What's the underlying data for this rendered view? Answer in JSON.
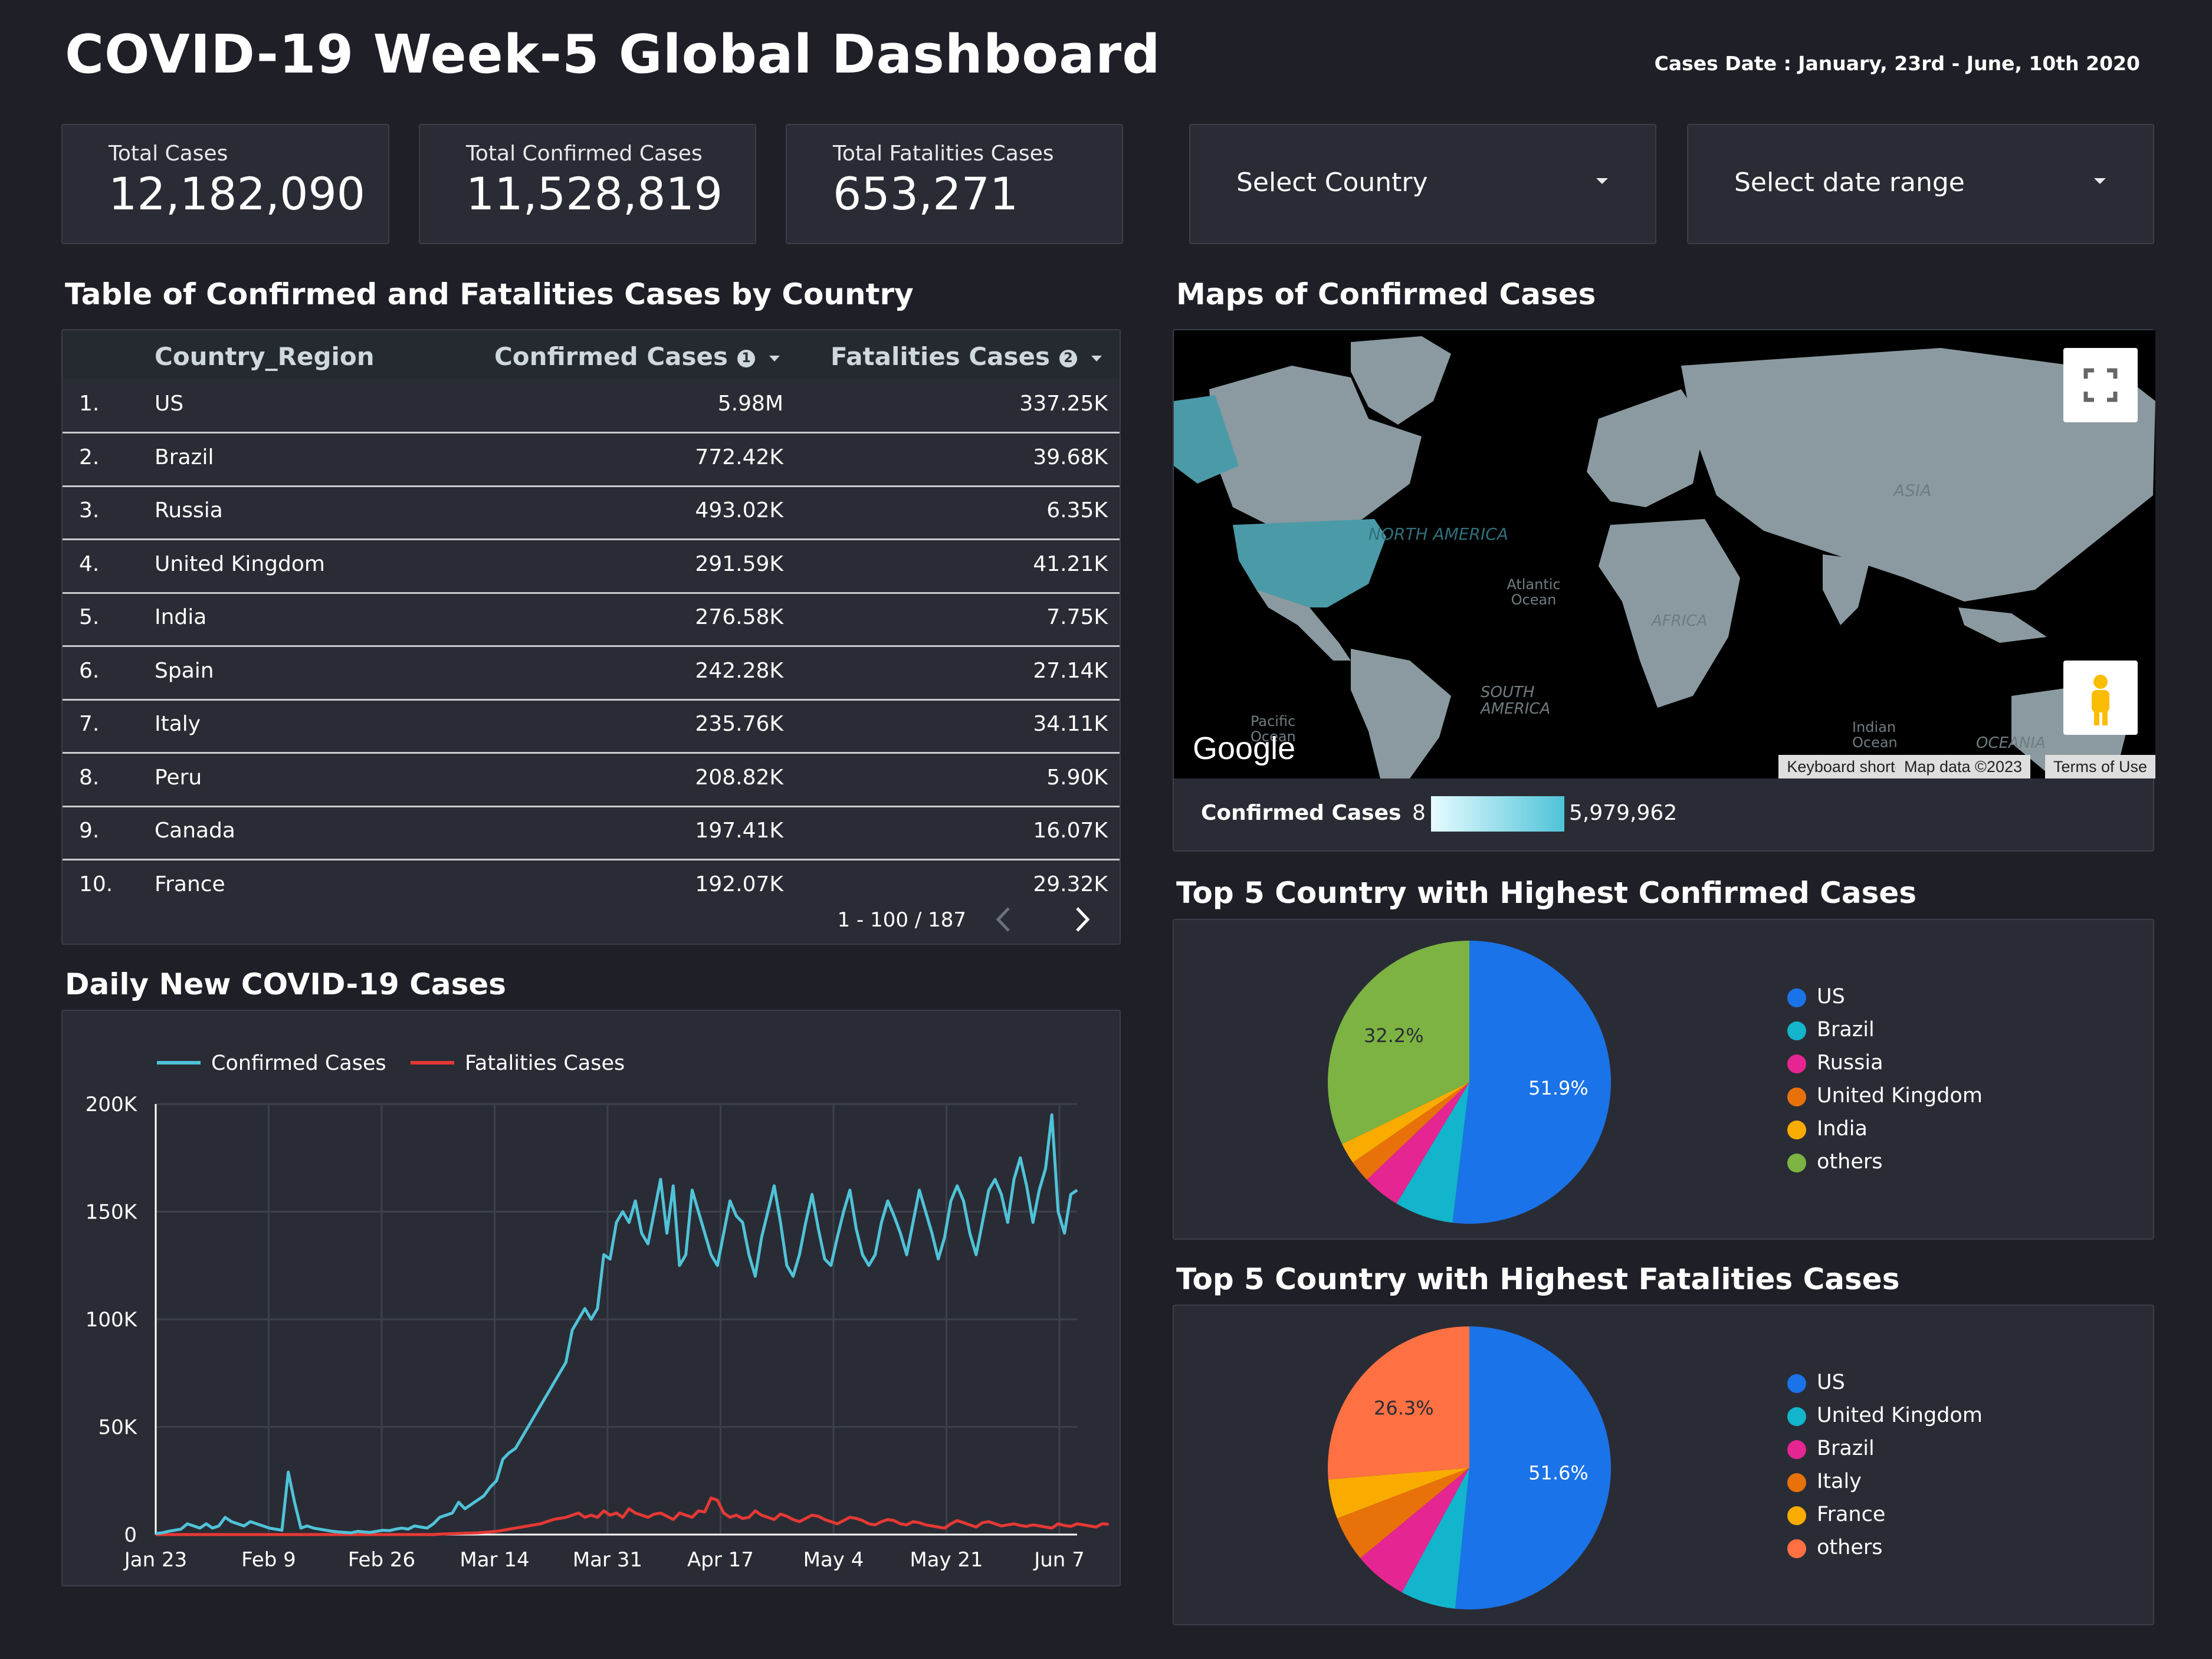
{
  "header": {
    "title": "COVID-19 Week-5 Global Dashboard",
    "date_range": "Cases Date : January, 23rd - June, 10th 2020"
  },
  "kpis": [
    {
      "label": "Total Cases",
      "value": "12,182,090"
    },
    {
      "label": "Total Confirmed Cases",
      "value": "11,528,819"
    },
    {
      "label": "Total Fatalities Cases",
      "value": "653,271"
    }
  ],
  "filters": {
    "country": "Select Country",
    "date": "Select date range"
  },
  "table": {
    "title": "Table of Confirmed and Fatalities Cases by Country",
    "headers": {
      "country": "Country_Region",
      "confirmed": "Confirmed Cases",
      "fatalities": "Fatalities Cases",
      "confirmed_info": "1",
      "fatalities_info": "2"
    },
    "rows": [
      {
        "n": "1.",
        "country": "US",
        "confirmed": "5.98M",
        "fatalities": "337.25K"
      },
      {
        "n": "2.",
        "country": "Brazil",
        "confirmed": "772.42K",
        "fatalities": "39.68K"
      },
      {
        "n": "3.",
        "country": "Russia",
        "confirmed": "493.02K",
        "fatalities": "6.35K"
      },
      {
        "n": "4.",
        "country": "United Kingdom",
        "confirmed": "291.59K",
        "fatalities": "41.21K"
      },
      {
        "n": "5.",
        "country": "India",
        "confirmed": "276.58K",
        "fatalities": "7.75K"
      },
      {
        "n": "6.",
        "country": "Spain",
        "confirmed": "242.28K",
        "fatalities": "27.14K"
      },
      {
        "n": "7.",
        "country": "Italy",
        "confirmed": "235.76K",
        "fatalities": "34.11K"
      },
      {
        "n": "8.",
        "country": "Peru",
        "confirmed": "208.82K",
        "fatalities": "5.90K"
      },
      {
        "n": "9.",
        "country": "Canada",
        "confirmed": "197.41K",
        "fatalities": "16.07K"
      },
      {
        "n": "10.",
        "country": "France",
        "confirmed": "192.07K",
        "fatalities": "29.32K"
      }
    ],
    "pagination": "1 - 100 / 187"
  },
  "map": {
    "title": "Maps of Confirmed Cases",
    "labels": {
      "north_america": "NORTH AMERICA",
      "south_america": "SOUTH AMERICA",
      "asia": "ASIA",
      "africa": "AFRICA",
      "oceania": "OCEANIA",
      "atlantic": "Atlantic Ocean",
      "pacific": "Pacific Ocean",
      "indian": "Indian Ocean"
    },
    "logo": "Google",
    "attrib_shortcuts": "Keyboard shortcuts",
    "attrib_data": "Map data ©2023",
    "attrib_terms": "Terms of Use",
    "legend_label": "Confirmed Cases",
    "legend_min": "8",
    "legend_max": "5,979,962",
    "legend_color": "#4fc3d8"
  },
  "line_section": {
    "title": "Daily New COVID-19 Cases"
  },
  "pie1_section": {
    "title": "Top 5 Country with Highest Confirmed Cases"
  },
  "pie2_section": {
    "title": "Top 5 Country with Highest Fatalities Cases"
  },
  "chart_data": [
    {
      "type": "line",
      "title": "Daily New COVID-19 Cases",
      "x_ticks": [
        "Jan 23",
        "Feb 9",
        "Feb 26",
        "Mar 14",
        "Mar 31",
        "Apr 17",
        "May 4",
        "May 21",
        "Jun 7"
      ],
      "y_ticks": [
        "0",
        "50K",
        "100K",
        "150K",
        "200K"
      ],
      "ylim": [
        0,
        200000
      ],
      "grid": true,
      "legend_position": "top",
      "series": [
        {
          "name": "Confirmed Cases",
          "color": "#4fc3d8",
          "values": [
            500,
            800,
            1500,
            2000,
            2500,
            5000,
            4000,
            3000,
            5000,
            3000,
            4000,
            8000,
            6000,
            5000,
            4000,
            6000,
            5000,
            4000,
            3000,
            2500,
            2000,
            29000,
            15000,
            3000,
            4000,
            3000,
            2500,
            2000,
            1500,
            1200,
            1000,
            800,
            1500,
            1200,
            1000,
            1500,
            2000,
            1800,
            2500,
            3000,
            2500,
            4000,
            3500,
            3000,
            5000,
            8000,
            9000,
            10000,
            15000,
            12000,
            14000,
            16000,
            18000,
            22000,
            25000,
            35000,
            38000,
            40000,
            45000,
            50000,
            55000,
            60000,
            65000,
            70000,
            75000,
            80000,
            95000,
            100000,
            105000,
            100000,
            105000,
            130000,
            128000,
            145000,
            150000,
            145000,
            155000,
            140000,
            135000,
            150000,
            165000,
            140000,
            162000,
            125000,
            130000,
            160000,
            150000,
            140000,
            130000,
            125000,
            140000,
            155000,
            148000,
            145000,
            130000,
            120000,
            138000,
            150000,
            162000,
            145000,
            125000,
            120000,
            130000,
            145000,
            158000,
            142000,
            128000,
            125000,
            138000,
            150000,
            160000,
            142000,
            130000,
            125000,
            130000,
            145000,
            155000,
            148000,
            140000,
            130000,
            145000,
            160000,
            150000,
            140000,
            128000,
            138000,
            155000,
            162000,
            155000,
            140000,
            130000,
            145000,
            160000,
            165000,
            158000,
            145000,
            165000,
            175000,
            162000,
            145000,
            160000,
            170000,
            195000,
            150000,
            140000,
            158000,
            160000
          ]
        },
        {
          "name": "Fatalities Cases",
          "color": "#e53935",
          "values": [
            0,
            0,
            0,
            0,
            0,
            0,
            0,
            0,
            0,
            0,
            0,
            0,
            0,
            0,
            0,
            0,
            0,
            0,
            0,
            0,
            0,
            0,
            0,
            0,
            0,
            0,
            0,
            0,
            0,
            0,
            0,
            0,
            0,
            0,
            0,
            0,
            0,
            0,
            0,
            0,
            0,
            0,
            0,
            0,
            0,
            200,
            300,
            400,
            500,
            600,
            700,
            800,
            1000,
            1200,
            1500,
            2000,
            2500,
            3000,
            3500,
            4000,
            4500,
            5000,
            6000,
            7000,
            7500,
            8000,
            9000,
            10000,
            8000,
            9000,
            8000,
            11000,
            9000,
            10000,
            8000,
            12000,
            10000,
            9000,
            8000,
            9500,
            10000,
            8500,
            7000,
            10000,
            9000,
            8000,
            11000,
            10500,
            17000,
            16000,
            10000,
            8000,
            9000,
            7500,
            8000,
            11000,
            9000,
            8000,
            7000,
            9500,
            8500,
            7000,
            6000,
            7500,
            9000,
            8500,
            7000,
            6000,
            5000,
            6500,
            8000,
            7500,
            6500,
            5000,
            4500,
            6000,
            7000,
            6500,
            5000,
            4500,
            6000,
            5500,
            4500,
            4000,
            3500,
            3000,
            5000,
            6500,
            5500,
            4500,
            3500,
            5500,
            6000,
            5000,
            4000,
            4500,
            5000,
            4200,
            3800,
            4500,
            4000,
            3500,
            3000,
            5000,
            4200,
            3800,
            5000,
            4500,
            4000,
            3500,
            5000,
            4800
          ]
        }
      ]
    },
    {
      "type": "pie",
      "title": "Top 5 Country with Highest Confirmed Cases",
      "categories": [
        "US",
        "Brazil",
        "Russia",
        "United Kingdom",
        "India",
        "others"
      ],
      "values": [
        51.9,
        6.7,
        4.3,
        2.5,
        2.4,
        32.2
      ],
      "colors": [
        "#1a73e8",
        "#12b5cb",
        "#e52592",
        "#e8710a",
        "#f9ab00",
        "#7cb342"
      ],
      "labels": [
        "51.9%",
        "",
        "",
        "",
        "",
        "32.2%"
      ],
      "legend_position": "right"
    },
    {
      "type": "pie",
      "title": "Top 5 Country with Highest Fatalities Cases",
      "categories": [
        "US",
        "United Kingdom",
        "Brazil",
        "Italy",
        "France",
        "others"
      ],
      "values": [
        51.6,
        6.3,
        6.1,
        5.2,
        4.5,
        26.3
      ],
      "colors": [
        "#1a73e8",
        "#12b5cb",
        "#e52592",
        "#e8710a",
        "#f9ab00",
        "#ff7043"
      ],
      "labels": [
        "51.6%",
        "",
        "",
        "",
        "",
        "26.3%"
      ],
      "legend_position": "right"
    }
  ]
}
